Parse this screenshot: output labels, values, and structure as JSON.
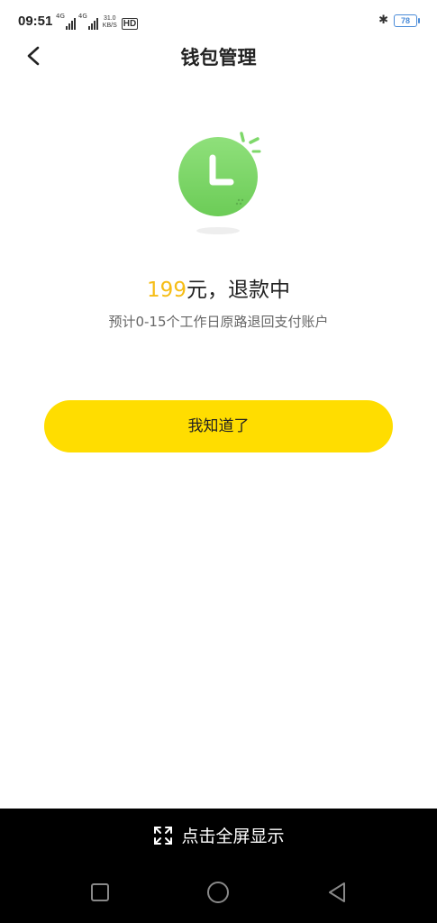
{
  "status_bar": {
    "time": "09:51",
    "net1": "4G",
    "net2": "4G",
    "speed_value": "31.0",
    "speed_unit": "KB/S",
    "hd": "HD",
    "battery": "78"
  },
  "header": {
    "title": "钱包管理",
    "back_icon": "chevron-left-icon"
  },
  "status": {
    "icon": "clock-icon",
    "amount": "199",
    "text": "元，退款中",
    "hint": "预计0-15个工作日原路退回支付账户"
  },
  "actions": {
    "confirm_label": "我知道了"
  },
  "overlay": {
    "fullscreen_label": "点击全屏显示",
    "fullscreen_icon": "expand-icon"
  },
  "nav_bar": {
    "recent_icon": "square-icon",
    "home_icon": "circle-icon",
    "back_icon": "triangle-back-icon"
  },
  "colors": {
    "accent_yellow": "#ffdd00",
    "amount_color": "#f6bd16",
    "clock_green": "#7ed86a"
  }
}
